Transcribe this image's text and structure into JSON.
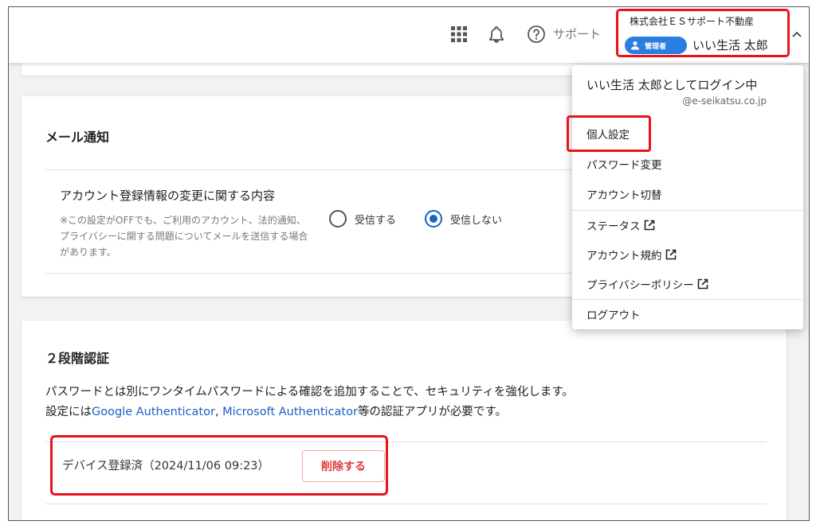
{
  "header": {
    "support_label": "サポート",
    "company_name": "株式会社ＥＳサポート不動産",
    "role_badge": "管理者",
    "user_name": "いい生活 太郎"
  },
  "menu": {
    "login_as": "いい生活 太郎としてログイン中",
    "email": "@e-seikatsu.co.jp",
    "items": [
      {
        "label": "個人設定",
        "external": false
      },
      {
        "label": "パスワード変更",
        "external": false
      },
      {
        "label": "アカウント切替",
        "external": false
      },
      {
        "label": "ステータス",
        "external": true
      },
      {
        "label": "アカウント規約",
        "external": true
      },
      {
        "label": "プライバシーポリシー",
        "external": true
      },
      {
        "label": "ログアウト",
        "external": false
      }
    ]
  },
  "mail": {
    "title": "メール通知",
    "pref_heading": "アカウント登録情報の変更に関する内容",
    "pref_note": "※この設定がOFFでも、ご利用のアカウント、法的通知、プライバシーに関する問題についてメールを送信する場合があります。",
    "options": [
      {
        "label": "受信する",
        "selected": false
      },
      {
        "label": "受信しない",
        "selected": true
      }
    ]
  },
  "twofa": {
    "title": "２段階認証",
    "desc_line1": "パスワードとは別にワンタイムパスワードによる確認を追加することで、セキュリティを強化します。",
    "desc_prefix": "設定には",
    "app1": "Google Authenticator",
    "sep": ", ",
    "app2": "Microsoft Authenticator",
    "desc_suffix": "等の認証アプリが必要です。",
    "device_status": "デバイス登録済（2024/11/06 09:23）",
    "delete_label": "削除する"
  },
  "colors": {
    "accent": "#1764c0",
    "highlight": "#e8141b",
    "danger": "#e03a3a",
    "badge": "#2a7de1"
  }
}
